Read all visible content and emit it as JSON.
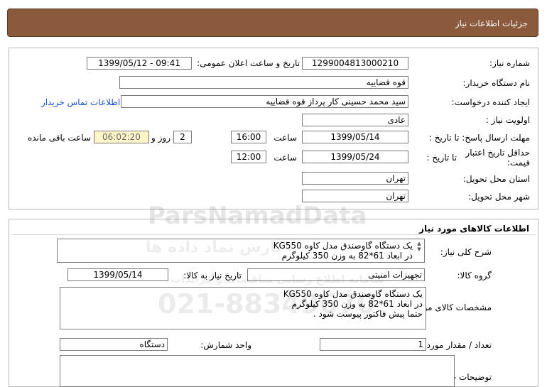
{
  "header": {
    "title": "جزئیات اطلاعات نیاز"
  },
  "details": {
    "need_number_label": "شماره نیاز:",
    "need_number": "1299004813000210",
    "announce_label": "تاریخ و ساعت اعلان عمومی:",
    "announce_value": "1399/05/12 - 09:41",
    "buyer_org_label": "نام دستگاه خریدار:",
    "buyer_org": "قوه قضاییه",
    "creator_label": "ایجاد کننده درخواست:",
    "creator": "سید محمد حسینی کار پرداز  قوه قضاییه",
    "contact_link": "اطلاعات تماس خریدار",
    "priority_label": "اولویت نیاز :",
    "priority": "عادی",
    "deadline_label": "مهلت ارسال پاسخ: تا تاریخ :",
    "deadline_date": "1399/05/14",
    "time_label": "ساعت",
    "deadline_time": "16:00",
    "days_value": "2",
    "days_label": "روز و",
    "remaining_value": "06:02:20",
    "remaining_label": "ساعت باقی مانده",
    "price_valid_label": "حداقل تاریخ اعتبار قیمت:",
    "price_valid_until": "تا تاریخ :",
    "price_valid_date": "1399/05/24",
    "price_valid_time_label": "ساعت",
    "price_valid_time": "12:00",
    "province_label": "استان محل تحویل:",
    "province": "تهران",
    "city_label": "شهر محل تحویل:",
    "city": "تهران"
  },
  "goods": {
    "title": "اطلاعات کالاهای مورد نیاز",
    "summary_label": "شرح کلی نیاز:",
    "summary_text": "یک دستگاه گاوصندق مدل کاوه KG550\nدر ابعاد 61*82 به وزن 350 کیلوگرم",
    "group_label": "گروه کالا:",
    "group_value": "تجهیزات امنیتی",
    "need_date_label": "تاریخ نیاز به کالا:",
    "need_date": "1399/05/14",
    "specs_label": "مشخصات کالای مورد نیاز:",
    "specs_text": "یک دستگاه گاوصندق مدل کاوه KG550\nدر ابعاد 61*82 به وزن 350 کیلوگرم\nحتما پیش فاکتور پیوست شود .",
    "qty_label": "تعداد / مقدار مورد نیاز:",
    "qty_value": "1",
    "unit_label": "واحد شمارش:",
    "unit_value": "دستگاه",
    "buyer_notes_label": "توضیحات خریدار:",
    "buyer_notes": ""
  },
  "watermark": {
    "brand": "ParsNamadData",
    "persian": "پارس نماد داده ها",
    "subtitle": "سامانه اطلاع رسانی مناقصات و مزایدات",
    "phone": "021-88349670"
  }
}
